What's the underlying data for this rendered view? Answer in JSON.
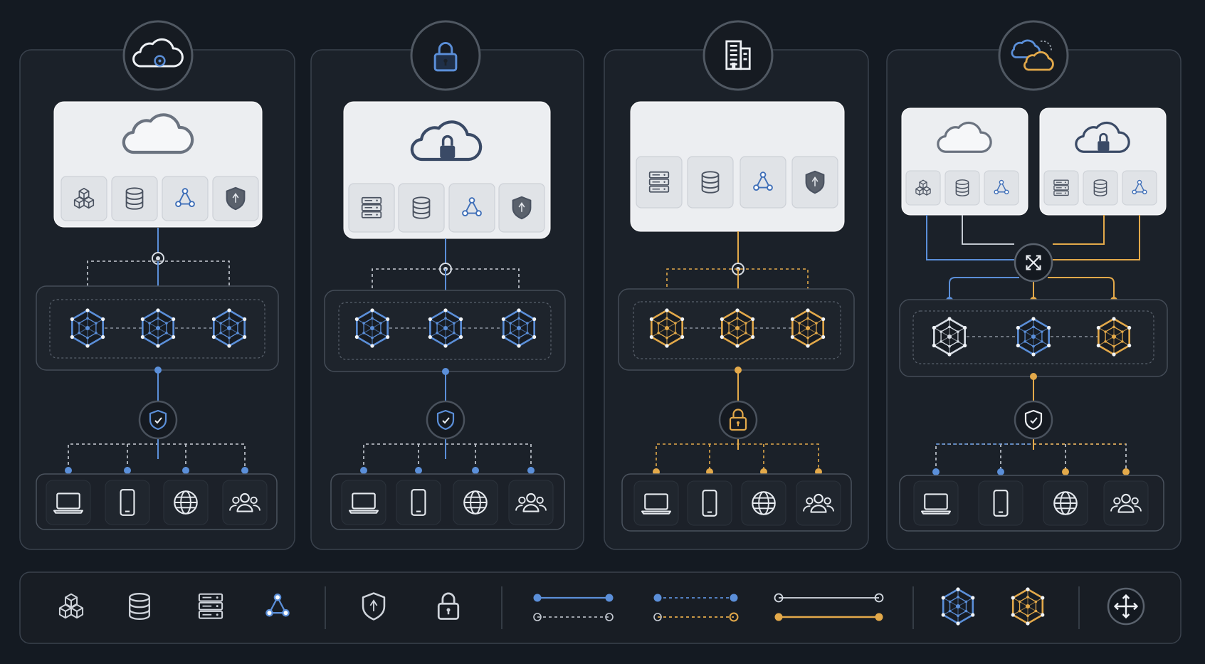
{
  "colors": {
    "background": "#141a22",
    "panel": "#1b2129",
    "panel_border": "#3a424d",
    "card": "#eceef1",
    "card_tile": "#e0e3e7",
    "icon_dark": "#4a5260",
    "blue": "#5b8fd9",
    "gold": "#e3a94a",
    "node_dark": "#171c23",
    "node_light": "#d7dde5",
    "dashed_white": "#c9ced6"
  },
  "columns": [
    {
      "id": "public-cloud",
      "header_icon": "cloud-gear-icon",
      "accent": "blue",
      "cloud_card_icon": "cloud-icon",
      "card_services": [
        "cubes-icon",
        "database-icon",
        "network-nodes-icon",
        "shield-icon"
      ],
      "cluster_nodes": [
        "blue",
        "blue",
        "blue"
      ],
      "security_icon": "shield-check-icon",
      "endpoints": [
        "laptop-icon",
        "smartphone-icon",
        "globe-icon",
        "users-icon"
      ]
    },
    {
      "id": "private-cloud",
      "header_icon": "padlock-icon",
      "accent": "blue",
      "cloud_card_icon": "cloud-lock-icon",
      "card_services": [
        "server-rack-icon",
        "database-icon",
        "network-nodes-icon",
        "shield-icon"
      ],
      "cluster_nodes": [
        "blue",
        "blue",
        "blue"
      ],
      "security_icon": "shield-check-icon",
      "endpoints": [
        "laptop-icon",
        "smartphone-icon",
        "globe-icon",
        "users-icon"
      ]
    },
    {
      "id": "on-premises",
      "header_icon": "building-icon",
      "accent": "gold",
      "cloud_card_icon": "",
      "card_services": [
        "server-rack-icon",
        "database-icon",
        "network-nodes-icon",
        "shield-icon"
      ],
      "cluster_nodes": [
        "gold",
        "gold",
        "gold"
      ],
      "security_icon": "padlock-icon",
      "endpoints": [
        "laptop-icon",
        "smartphone-icon",
        "globe-icon",
        "users-icon"
      ]
    },
    {
      "id": "hybrid-cloud",
      "header_icon": "hybrid-clouds-icon",
      "accent": "mixed",
      "cloud_cards": [
        {
          "cloud_icon": "cloud-icon",
          "services": [
            "cubes-icon",
            "database-icon",
            "network-nodes-icon"
          ]
        },
        {
          "cloud_icon": "cloud-lock-icon",
          "services": [
            "server-rack-icon",
            "database-icon",
            "network-nodes-icon"
          ]
        }
      ],
      "hub_icon": "crossing-arrows-icon",
      "cluster_nodes": [
        "white",
        "blue",
        "gold"
      ],
      "security_icon": "shield-check-icon",
      "endpoints": [
        "laptop-icon",
        "smartphone-icon",
        "globe-icon",
        "users-icon"
      ]
    }
  ],
  "legend": {
    "groups": [
      [
        "cubes-icon",
        "database-icon",
        "server-rack-icon",
        "network-nodes-icon"
      ],
      [
        "shield-icon",
        "padlock-icon"
      ],
      [
        "line-blue-solid",
        "line-blue-gold-dashed",
        "line-white-gold-solid"
      ],
      [
        "node-blue-icon",
        "node-gold-icon"
      ],
      [
        "move-arrows-icon"
      ]
    ]
  }
}
